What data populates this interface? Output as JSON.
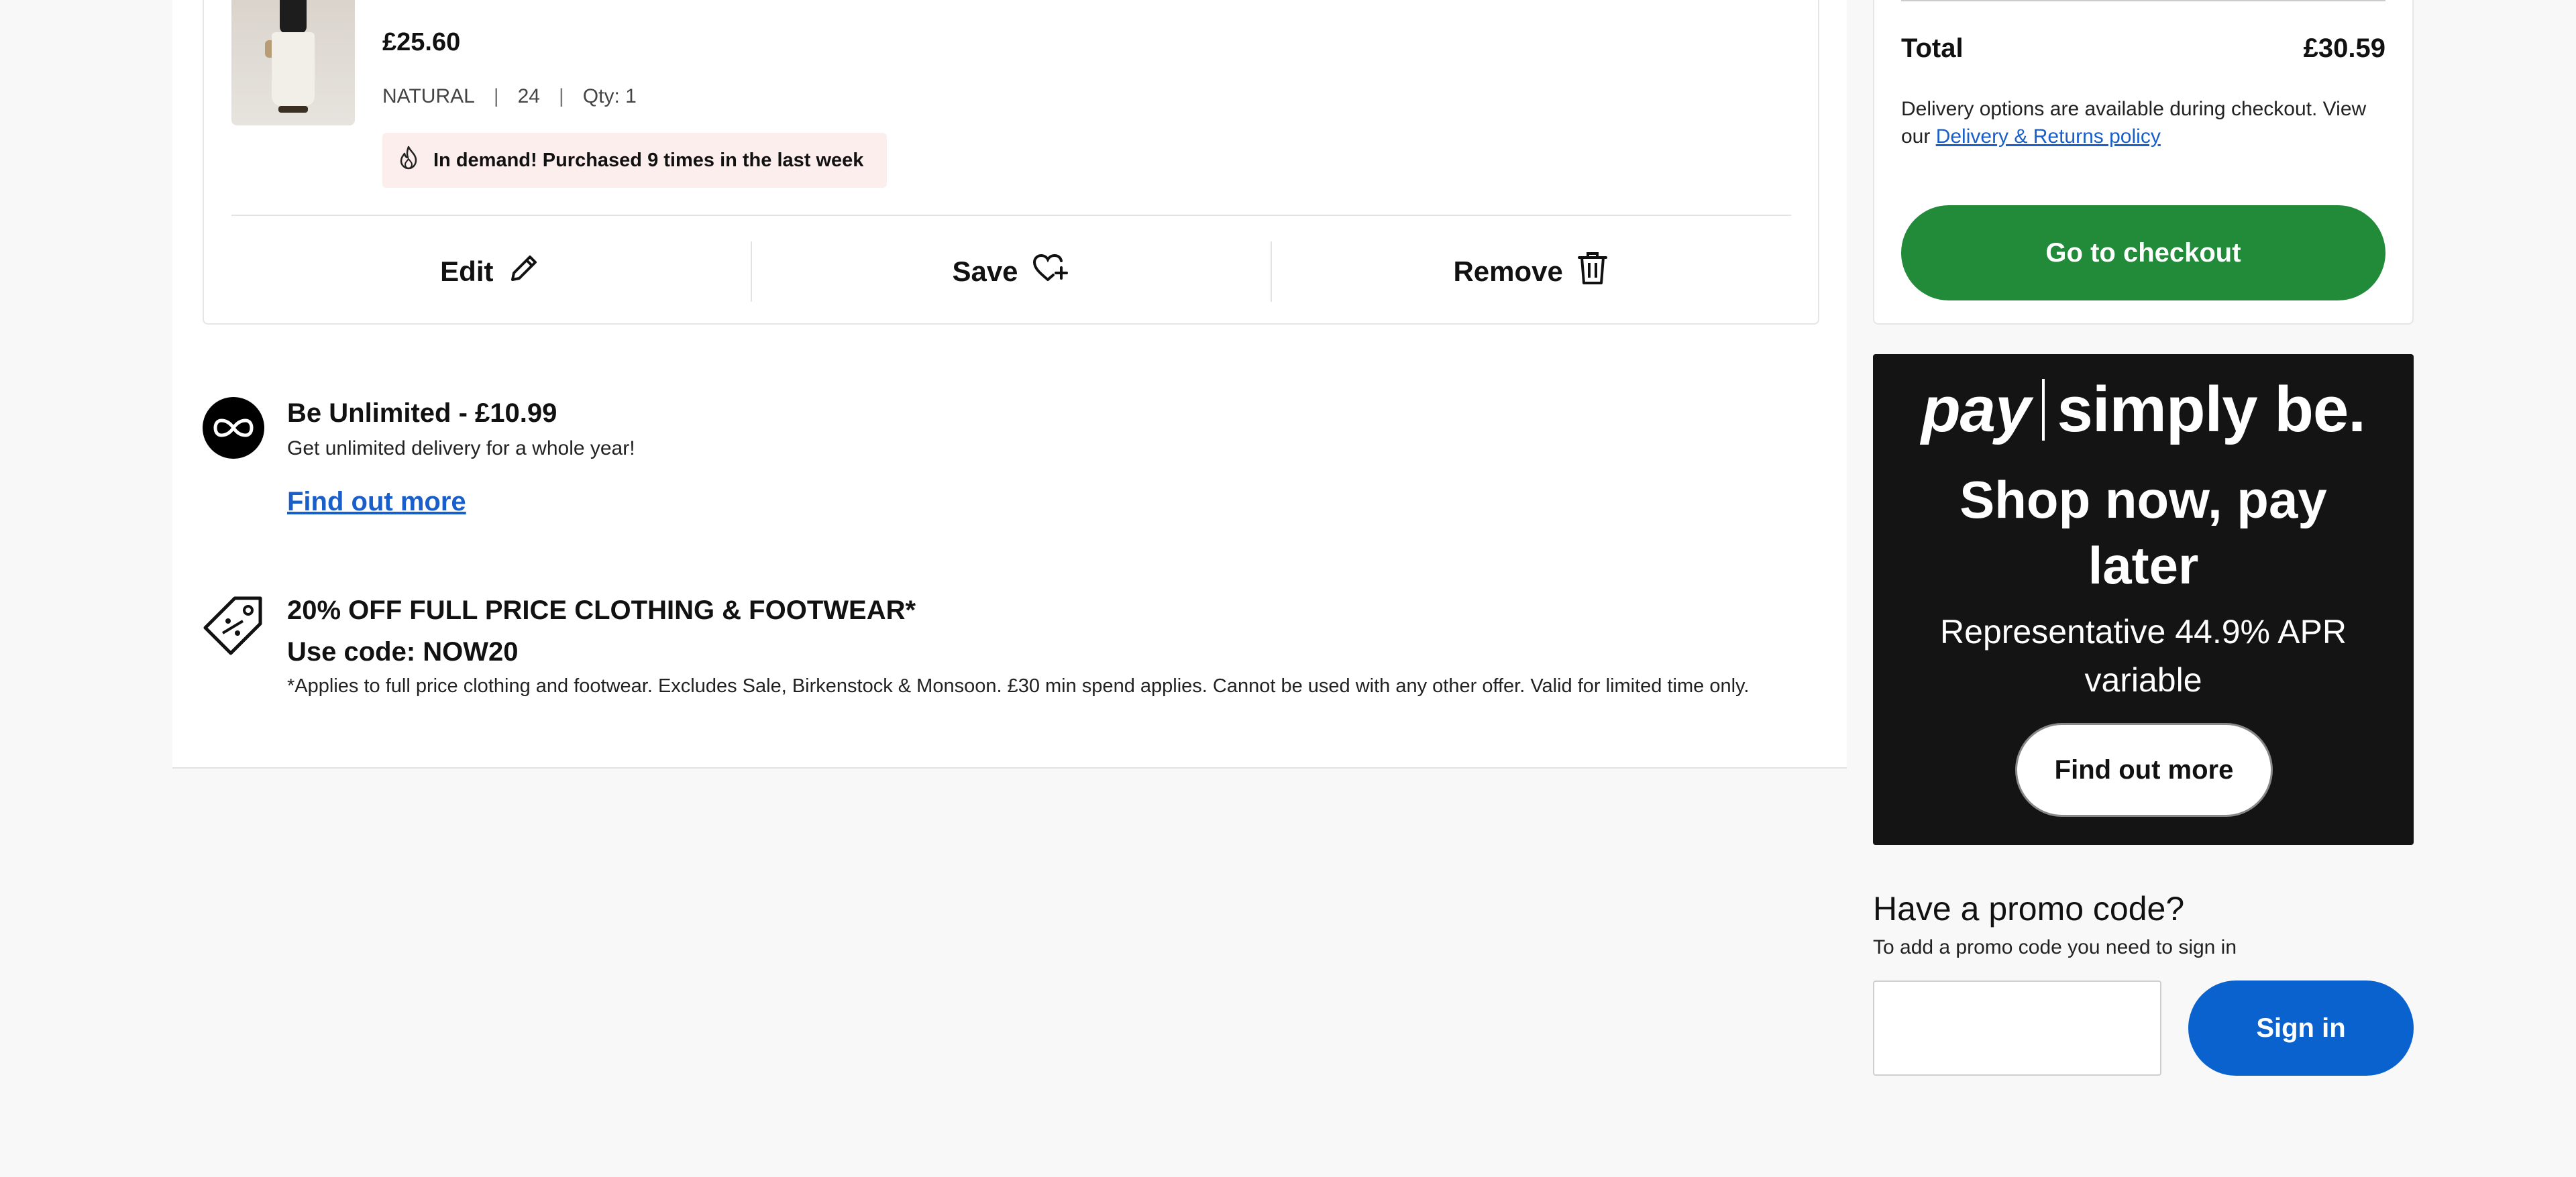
{
  "basket_item": {
    "price": "£25.60",
    "colour": "NATURAL",
    "size": "24",
    "separator": "|",
    "qty": "Qty: 1",
    "demand_text": "In demand! Purchased 9 times in the last week",
    "actions": {
      "edit": "Edit",
      "save": "Save",
      "remove": "Remove"
    }
  },
  "unlimited": {
    "title": "Be Unlimited - £10.99",
    "subtitle": "Get unlimited delivery for a whole year!",
    "link": "Find out more"
  },
  "offer": {
    "title": "20% OFF FULL PRICE CLOTHING & FOOTWEAR*",
    "code_line": "Use code: NOW20",
    "terms": "*Applies to full price clothing and footwear. Excludes Sale, Birkenstock & Monsoon. £30 min spend applies. Cannot be used with any other offer. Valid for limited time only."
  },
  "summary": {
    "total_label": "Total",
    "total_value": "£30.59",
    "delivery_note": "Delivery options are available during checkout. View our",
    "delivery_link": "Delivery & Returns policy",
    "checkout_button": "Go to checkout"
  },
  "pay_banner": {
    "logo_pay": "pay",
    "logo_brand": "simply be.",
    "headline": "Shop now, pay later",
    "apr": "Representative 44.9% APR variable",
    "button": "Find out more"
  },
  "promo": {
    "heading": "Have a promo code?",
    "subtext": "To add a promo code you need to sign in",
    "input_value": "",
    "sign_in_button": "Sign in"
  },
  "colors": {
    "checkout_green": "#228b3a",
    "sign_in_blue": "#0a62cf",
    "link_blue": "#1a5fc9",
    "banner_black": "#141414",
    "demand_bg": "#fbeeed"
  }
}
